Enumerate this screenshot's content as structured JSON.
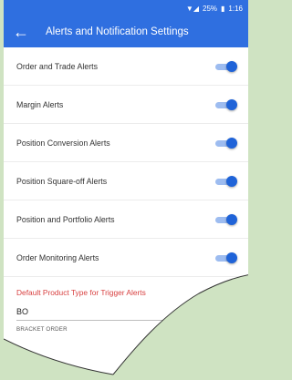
{
  "statusbar": {
    "signal_icon": "signal-wifi-icon",
    "battery": "25%",
    "battery_icon": "battery-icon",
    "time": "1:16"
  },
  "appbar": {
    "back_icon": "arrow-back-icon",
    "title": "Alerts and Notification Settings"
  },
  "settings": [
    {
      "label": "Order and Trade Alerts",
      "enabled": true
    },
    {
      "label": "Margin Alerts",
      "enabled": true
    },
    {
      "label": "Position Conversion Alerts",
      "enabled": true
    },
    {
      "label": "Position Square-off Alerts",
      "enabled": true
    },
    {
      "label": "Position and Portfolio Alerts",
      "enabled": true
    },
    {
      "label": "Order Monitoring Alerts",
      "enabled": true
    }
  ],
  "product_type": {
    "heading": "Default Product Type for Trigger Alerts",
    "selected_value": "BO",
    "description": "BRACKET ORDER"
  },
  "colors": {
    "primary": "#2f6fe0",
    "accent_heading": "#d84040",
    "background": "#cfe3c2"
  }
}
